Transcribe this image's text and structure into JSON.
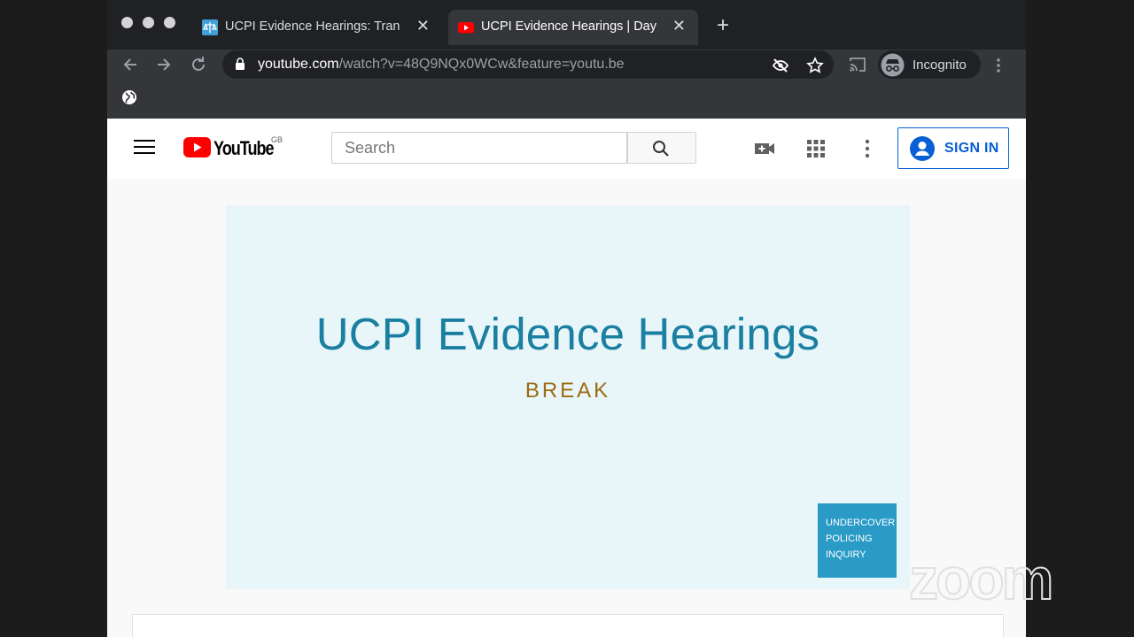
{
  "browser": {
    "tabs": [
      {
        "label": "UCPI Evidence Hearings: Tran",
        "active": false,
        "icon": "scales-icon"
      },
      {
        "label": "UCPI Evidence Hearings | Day",
        "active": true,
        "icon": "youtube-icon"
      }
    ],
    "url_host": "youtube.com",
    "url_path": "/watch?v=48Q9NQx0WCw&feature=youtu.be",
    "incognito_label": "Incognito"
  },
  "youtube": {
    "logo_text": "YouTube",
    "region": "GB",
    "search_placeholder": "Search",
    "signin_label": "SIGN IN",
    "brand_color": "#ff0000",
    "accent_color": "#065fd4"
  },
  "video": {
    "title": "UCPI Evidence Hearings",
    "subtitle": "BREAK",
    "badge_lines": [
      "UNDERCOVER",
      "POLICING",
      "INQUIRY"
    ]
  },
  "overlay": {
    "watermark": "zoom"
  }
}
